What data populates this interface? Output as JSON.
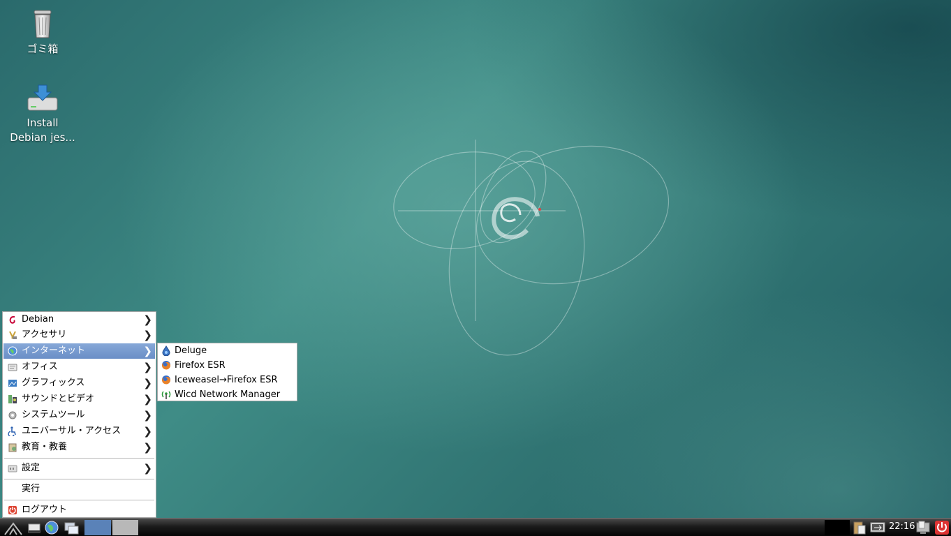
{
  "desktop": {
    "icons": [
      {
        "label": "ゴミ箱",
        "icon": "trash-icon"
      },
      {
        "label": "Install\nDebian jes...",
        "line1": "Install",
        "line2": "Debian jes...",
        "icon": "install-drive-icon"
      }
    ]
  },
  "menu": {
    "items": [
      {
        "label": "Debian",
        "icon": "debian-swirl-icon"
      },
      {
        "label": "アクセサリ",
        "icon": "accessories-icon"
      },
      {
        "label": "インターネット",
        "icon": "internet-globe-icon"
      },
      {
        "label": "オフィス",
        "icon": "office-icon"
      },
      {
        "label": "グラフィックス",
        "icon": "graphics-icon"
      },
      {
        "label": "サウンドとビデオ",
        "icon": "sound-video-icon"
      },
      {
        "label": "システムツール",
        "icon": "system-tools-icon"
      },
      {
        "label": "ユニバーサル・アクセス",
        "icon": "universal-access-icon"
      },
      {
        "label": "教育・教養",
        "icon": "education-icon"
      },
      {
        "label": "設定",
        "icon": "settings-icon"
      },
      {
        "label": "実行",
        "icon": ""
      },
      {
        "label": "ログアウト",
        "icon": "logout-icon"
      }
    ],
    "arrow": "❯"
  },
  "submenu": {
    "items": [
      {
        "label": "Deluge",
        "icon": "deluge-icon"
      },
      {
        "label": "Firefox ESR",
        "icon": "firefox-icon"
      },
      {
        "label": "Iceweasel→Firefox ESR",
        "icon": "iceweasel-icon"
      },
      {
        "label": "Wicd Network Manager",
        "icon": "wicd-icon"
      }
    ]
  },
  "taskbar": {
    "clock": "22:16",
    "colors": {
      "accent_active": "#6a8ec6",
      "desktop": "#2e6e6c"
    }
  }
}
